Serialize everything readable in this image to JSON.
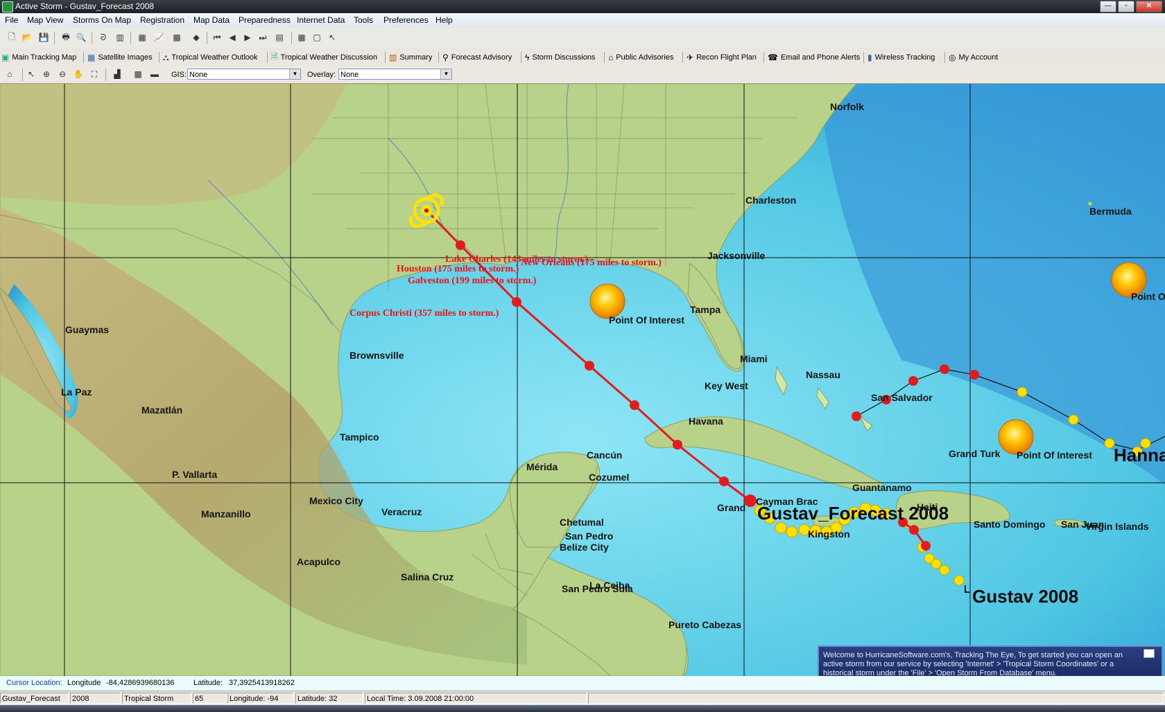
{
  "window": {
    "title": "Active Storm - Gustav_Forecast 2008"
  },
  "menu": [
    "File",
    "Map View",
    "Storms On Map",
    "Registration",
    "Map Data",
    "Preparedness",
    "Internet Data",
    "Tools",
    "Preferences",
    "Help"
  ],
  "nav": {
    "items": [
      {
        "label": "Main Tracking Map",
        "icon": "map-icon"
      },
      {
        "label": "Satellite Images",
        "icon": "satellite-icon"
      },
      {
        "label": "Tropical Weather Outlook",
        "icon": "binoculars-icon"
      },
      {
        "label": "Tropical Weather Discussion",
        "icon": "document-icon"
      },
      {
        "label": "Summary",
        "icon": "chart-icon"
      },
      {
        "label": "Forecast Advisory",
        "icon": "person-icon"
      },
      {
        "label": "Storm Discussions",
        "icon": "lightning-icon"
      },
      {
        "label": "Public Advisories",
        "icon": "house-icon"
      },
      {
        "label": "Recon Flight Plan",
        "icon": "airplane-icon"
      },
      {
        "label": "Email and Phone Alerts",
        "icon": "phone-icon"
      },
      {
        "label": "Wireless Tracking",
        "icon": "wireless-icon"
      },
      {
        "label": "My Account",
        "icon": "account-icon"
      }
    ]
  },
  "mapbar": {
    "gis_label": "GIS:",
    "gis_value": "None",
    "overlay_label": "Overlay:",
    "overlay_value": "None"
  },
  "map": {
    "cities": [
      {
        "name": "Norfolk"
      },
      {
        "name": "Charleston"
      },
      {
        "name": "Jacksonville"
      },
      {
        "name": "Bermuda"
      },
      {
        "name": "Tampa"
      },
      {
        "name": "Miami"
      },
      {
        "name": "Key West"
      },
      {
        "name": "Nassau"
      },
      {
        "name": "San Salvador"
      },
      {
        "name": "Havana"
      },
      {
        "name": "Grand Turk"
      },
      {
        "name": "Guantanamo"
      },
      {
        "name": "Haiti"
      },
      {
        "name": "Santo Domingo"
      },
      {
        "name": "San Juan"
      },
      {
        "name": "Virgin Islands"
      },
      {
        "name": "Cayman Brac"
      },
      {
        "name": "Grand"
      },
      {
        "name": "Kingston"
      },
      {
        "name": "Guaymas"
      },
      {
        "name": "La Paz"
      },
      {
        "name": "Mazatlán"
      },
      {
        "name": "Brownsville"
      },
      {
        "name": "Tampico"
      },
      {
        "name": "P. Vallarta"
      },
      {
        "name": "Manzanillo"
      },
      {
        "name": "Mexico City"
      },
      {
        "name": "Veracruz"
      },
      {
        "name": "Acapulco"
      },
      {
        "name": "Salina Cruz"
      },
      {
        "name": "Mérida"
      },
      {
        "name": "Cancún"
      },
      {
        "name": "Cozumel"
      },
      {
        "name": "Chetumal"
      },
      {
        "name": "San Pedro"
      },
      {
        "name": "Belize City"
      },
      {
        "name": "La Ceiba"
      },
      {
        "name": "San Pedro Sula"
      },
      {
        "name": "Pureto Cabezas"
      }
    ],
    "storm_labels": [
      "Lake Charles (143 miles to storm.)",
      "New Orleans (175 miles to storm.)",
      "Houston (175 miles to storm.)",
      "Galveston (199 miles to storm.)",
      "Corpus Christi (357 miles to storm.)"
    ],
    "poi_label": "Point Of Interest",
    "storms": [
      {
        "name": "Gustav 2008"
      },
      {
        "name": "Gustav_Forecast 2008"
      },
      {
        "name": "Hanna"
      }
    ]
  },
  "welcome": {
    "text": "Welcome to HurricaneSoftware.com's, Tracking The Eye, To get started you can open an active storm from our service by selecting 'Internet' > 'Tropical Storm Coordinates' or a historical storm under the 'File' > 'Open Storm From Database' menu."
  },
  "cursor": {
    "label": "Cursor Location:",
    "lon_label": "Longitude",
    "lon": "-84,4286939680136",
    "lat_label": "Latitude:",
    "lat": "37,3925413918262"
  },
  "status": {
    "storm": "Gustav_Forecast",
    "year": "2008",
    "type": "Tropical Storm",
    "wind": "65",
    "longitude": "Longitude: -94",
    "latitude": "Latitude: 32",
    "local_time": "Local Time: 3.09.2008 21:00:00"
  },
  "colors": {
    "sea": "#5fd0e8",
    "land": "#b7d089",
    "track": "#e21b1b"
  }
}
